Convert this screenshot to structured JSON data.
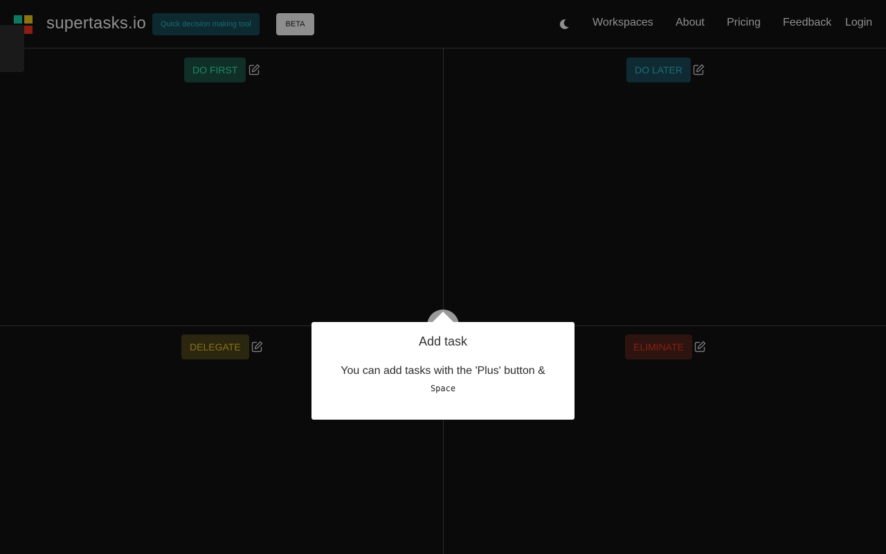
{
  "header": {
    "brand": "supertasks.io",
    "tagline": "Quick decision making tool",
    "badge": "BETA",
    "theme_icon": "moon-icon",
    "nav": [
      {
        "label": "Workspaces"
      },
      {
        "label": "About"
      },
      {
        "label": "Pricing"
      },
      {
        "label": "Feedback"
      },
      {
        "label": "Login"
      }
    ]
  },
  "logo_colors": [
    "#0d7a5f",
    "#8a7410",
    "#0e7f8c",
    "#8c1d12"
  ],
  "quadrants": [
    {
      "label": "DO FIRST",
      "color": "#1f8a66",
      "bg": "#0f2f27",
      "edit_icon": "edit-icon"
    },
    {
      "label": "DO LATER",
      "color": "#1e6f7a",
      "bg": "#0f2a32",
      "edit_icon": "edit-icon"
    },
    {
      "label": "DELEGATE",
      "color": "#8a7416",
      "bg": "#2b2610",
      "edit_icon": "edit-icon"
    },
    {
      "label": "ELIMINATE",
      "color": "#8a1f12",
      "bg": "#2d1410",
      "edit_icon": "edit-icon"
    }
  ],
  "tour_popover": {
    "title": "Add task",
    "body": "You can add tasks with the 'Plus' button &",
    "key": "Space"
  },
  "colors": {
    "background": "#0a0a0a",
    "tagline_text": "#1b6a74",
    "tagline_bg": "#0d2a30"
  }
}
